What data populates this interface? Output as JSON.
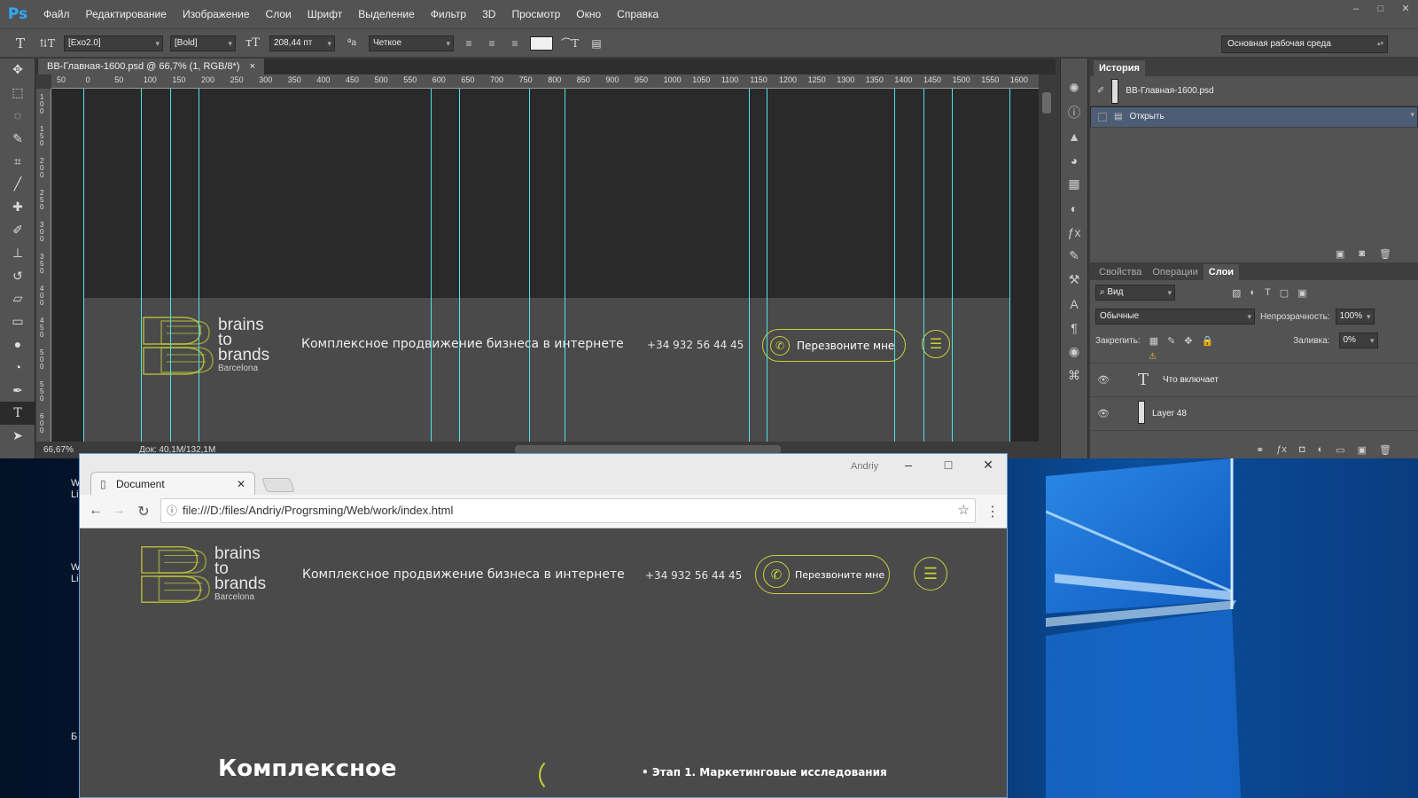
{
  "desktop": {
    "icon_labels": [
      "W\nLi",
      "W\nLi",
      "Б"
    ]
  },
  "photoshop": {
    "logo": "Ps",
    "menu": [
      "Файл",
      "Редактирование",
      "Изображение",
      "Слои",
      "Шрифт",
      "Выделение",
      "Фильтр",
      "3D",
      "Просмотр",
      "Окно",
      "Справка"
    ],
    "window_controls": [
      "–",
      "□",
      "✕"
    ],
    "options": {
      "font_family": "[Exo2.0]",
      "font_style": "[Bold]",
      "font_size": "208,44 пт",
      "antialias": "Четкое",
      "label_3d": "3D",
      "workspace": "Основная рабочая среда"
    },
    "doc_tab": "BB-Главная-1600.psd @ 66,7% (1, RGB/8*)",
    "doc_tab_close": "×",
    "ruler_h": [
      "50",
      "0",
      "50",
      "100",
      "150",
      "200",
      "250",
      "300",
      "350",
      "400",
      "450",
      "500",
      "550",
      "600",
      "650",
      "700",
      "750",
      "800",
      "850",
      "900",
      "950",
      "1000",
      "1050",
      "1100",
      "1150",
      "1200",
      "1250",
      "1300",
      "1350",
      "1400",
      "1450",
      "1500",
      "1550",
      "1600"
    ],
    "ruler_v": [
      "100",
      "150",
      "200",
      "250",
      "300",
      "350",
      "400",
      "450",
      "500",
      "550",
      "600"
    ],
    "status": {
      "zoom": "66,67%",
      "doc": "Док: 40,1M/132,1M"
    },
    "canvas_header": {
      "brand_lines": [
        "brains",
        "to",
        "brands"
      ],
      "city": "Barcelona",
      "tagline": "Комплексное продвижение бизнеса в интернете",
      "phone": "+34 932 56 44 45",
      "call_button": "Перезвоните мне"
    },
    "history_panel": {
      "tab": "История",
      "snapshot": "BB-Главная-1600.psd",
      "items": [
        "Открыть"
      ]
    },
    "layers_panel": {
      "tabs": [
        "Свойства",
        "Операции",
        "Слои"
      ],
      "active_tab": "Слои",
      "filter": "Вид",
      "blend_mode": "Обычные",
      "opacity_label": "Непрозрачность:",
      "opacity": "100%",
      "lock_label": "Закрепить:",
      "fill_label": "Заливка:",
      "fill": "0%",
      "layers": [
        {
          "name": "Что включает",
          "kind": "text"
        },
        {
          "name": "Layer 48",
          "kind": "pixel"
        }
      ]
    }
  },
  "browser": {
    "tab_title": "Document",
    "tab_close": "✕",
    "user": "Andriy",
    "controls": [
      "–",
      "□",
      "✕"
    ],
    "url": "file:///D:/files/Andriy/Progrsming/Web/work/index.html",
    "page": {
      "brand_lines": [
        "brains",
        "to",
        "brands"
      ],
      "city": "Barcelona",
      "tagline": "Комплексное продвижение бизнеса в интернете",
      "phone": "+34 932 56 44 45",
      "call_button": "Перезвоните мне",
      "section_heading": "Комплексное",
      "step_item": "Этап 1. Маркетинговые исследования"
    }
  },
  "colors": {
    "accent": "#c7d13b",
    "guide": "#4fe3e3",
    "ps_panel": "#535353",
    "site_bg": "#4a4a4a"
  }
}
